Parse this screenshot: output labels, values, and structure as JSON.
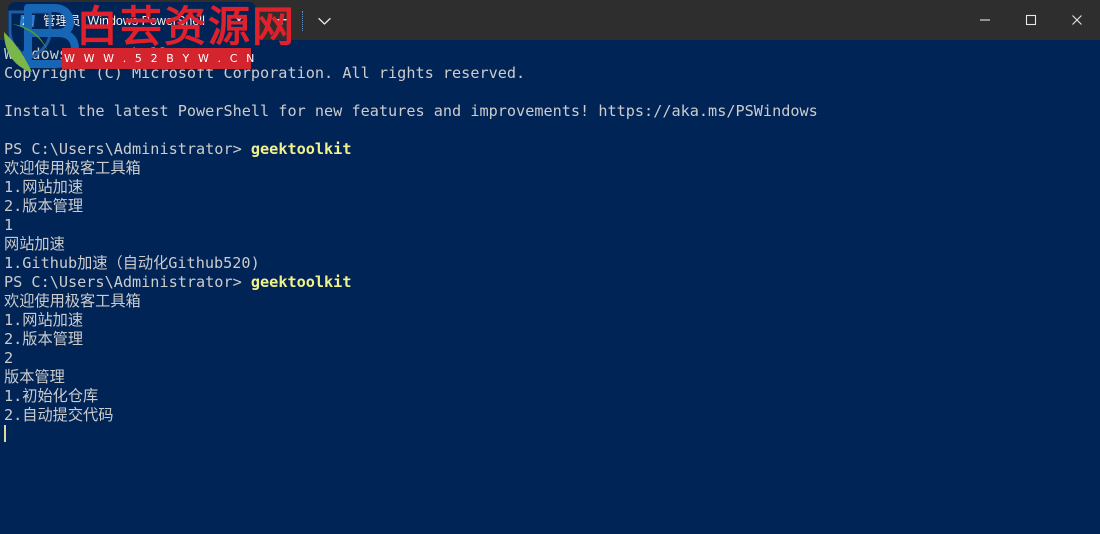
{
  "window": {
    "tab": {
      "title": "管理员: Windows PowerShell",
      "close_label": "✕",
      "icon_name": "powershell-icon"
    },
    "new_tab_label": "+",
    "dropdown_label": "⌄",
    "controls": {
      "minimize": "—",
      "maximize": "▢",
      "close": "✕"
    }
  },
  "watermark": {
    "site_name": "白芸资源网",
    "band_text": "W W W . 5 2 B Y W . C N",
    "logo_name": "baiyun-resource-logo",
    "color": "#e0202a",
    "band_color": "#d4242e"
  },
  "terminal": {
    "background": "#012456",
    "foreground": "#cccccc",
    "accent": "#f2f28c",
    "lines": [
      {
        "text": "Windows PowerShell"
      },
      {
        "text": "Copyright (C) Microsoft Corporation. All rights reserved."
      },
      {
        "text": ""
      },
      {
        "text": "Install the latest PowerShell for new features and improvements! https://aka.ms/PSWindows"
      },
      {
        "text": ""
      },
      {
        "prompt": "PS C:\\Users\\Administrator> ",
        "command": "geektoolkit"
      },
      {
        "text": "欢迎使用极客工具箱"
      },
      {
        "text": "1.网站加速"
      },
      {
        "text": "2.版本管理"
      },
      {
        "text": "1"
      },
      {
        "text": "网站加速"
      },
      {
        "text": "1.Github加速（自动化Github520)"
      },
      {
        "prompt": "PS C:\\Users\\Administrator> ",
        "command": "geektoolkit"
      },
      {
        "text": "欢迎使用极客工具箱"
      },
      {
        "text": "1.网站加速"
      },
      {
        "text": "2.版本管理"
      },
      {
        "text": "2"
      },
      {
        "text": "版本管理"
      },
      {
        "text": "1.初始化仓库"
      },
      {
        "text": "2.自动提交代码"
      },
      {
        "cursor": true
      }
    ]
  }
}
